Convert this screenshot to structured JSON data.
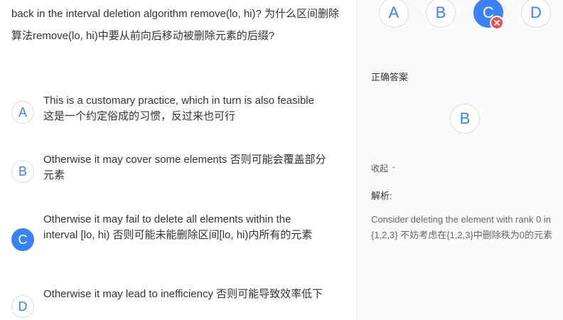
{
  "question": {
    "text": "back in the interval deletion algorithm remove(lo, hi)? 为什么区间删除算法remove(lo, hi)中要从前向后移动被删除元素的后缀?"
  },
  "options": [
    {
      "letter": "A",
      "text": "This is a customary practice, which in turn is also feasible 这是一个约定俗成的习惯，反过来也可行",
      "selected": false
    },
    {
      "letter": "B",
      "text": "Otherwise it may cover some elements 否则可能会覆盖部分元素",
      "selected": false
    },
    {
      "letter": "C",
      "text": "Otherwise it may fail to delete all elements within the interval [lo, hi) 否则可能未能删除区间[lo, hi)内所有的元素",
      "selected": true
    },
    {
      "letter": "D",
      "text": "Otherwise it may lead to inefficiency 否则可能导致效率低下",
      "selected": false
    }
  ],
  "answer_panel": {
    "choices": [
      {
        "letter": "A",
        "selected": false
      },
      {
        "letter": "B",
        "selected": false
      },
      {
        "letter": "C",
        "selected": true,
        "wrong": true
      },
      {
        "letter": "D",
        "selected": false
      }
    ],
    "correct_label": "正确答案",
    "correct_letter": "B",
    "collapse_label": "收起",
    "explanation_label": "解析:",
    "explanation_text": "Consider deleting the element with rank 0 in {1,2,3} 不妨考虑在{1,2,3}中删除秩为0的元素"
  },
  "colors": {
    "accent": "#3b82f6",
    "wrong": "#f0505a",
    "divider": "#e8e8e8"
  },
  "icons": {
    "wrong_badge": "close-icon",
    "collapse_caret": "chevron-up-icon"
  }
}
